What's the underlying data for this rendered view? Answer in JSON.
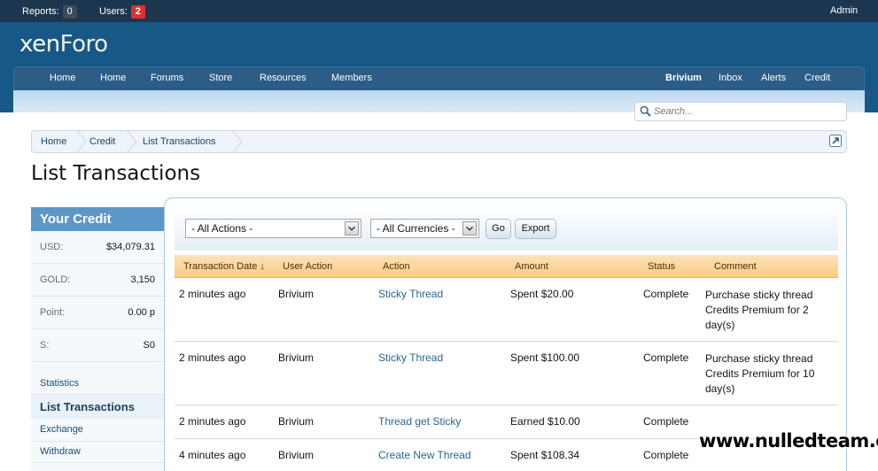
{
  "admin_bar": {
    "reports_label": "Reports:",
    "reports_count": "0",
    "users_label": "Users:",
    "users_count": "2",
    "admin_label": "Admin"
  },
  "header": {
    "logo_text_1": "xen",
    "logo_text_2": "Foro"
  },
  "nav": {
    "left_tabs": [
      "Home",
      "Home",
      "Forums",
      "Store",
      "Resources",
      "Members"
    ],
    "right_tabs": [
      "Brivium",
      "Inbox",
      "Alerts",
      "Credit"
    ]
  },
  "search": {
    "placeholder": "Search..."
  },
  "breadcrumb": [
    "Home",
    "Credit",
    "List Transactions"
  ],
  "page_title": "List Transactions",
  "sidebar": {
    "title": "Your Credit",
    "balances": [
      {
        "label": "USD:",
        "value": "$34,079.31"
      },
      {
        "label": "GOLD:",
        "value": "3,150"
      },
      {
        "label": "Point:",
        "value": "0.00 p"
      },
      {
        "label": "S:",
        "value": "S0"
      }
    ],
    "links": [
      "Statistics",
      "List Transactions",
      "Exchange",
      "Withdraw"
    ],
    "active_link": "List Transactions"
  },
  "filters": {
    "actions_value": "- All Actions -",
    "currencies_value": "- All Currencies -",
    "go_label": "Go",
    "export_label": "Export"
  },
  "table": {
    "columns": [
      "Transaction Date ↓",
      "User Action",
      "Action",
      "Amount",
      "Status",
      "Comment"
    ],
    "rows": [
      {
        "date": "2 minutes ago",
        "user": "Brivium",
        "action": "Sticky Thread",
        "amount": "Spent $20.00",
        "status": "Complete",
        "comment": " Purchase sticky thread Credits Premium for 2 day(s)"
      },
      {
        "date": "2 minutes ago",
        "user": "Brivium",
        "action": "Sticky Thread",
        "amount": "Spent $100.00",
        "status": "Complete",
        "comment": " Purchase sticky thread Credits Premium for 10 day(s)"
      },
      {
        "date": "2 minutes ago",
        "user": "Brivium",
        "action": "Thread get Sticky",
        "amount": "Earned $10.00",
        "status": "Complete",
        "comment": ""
      },
      {
        "date": "4 minutes ago",
        "user": "Brivium",
        "action": "Create New Thread",
        "amount": "Spent $108.34",
        "status": "Complete",
        "comment": ""
      }
    ]
  },
  "watermark": "www.nulledteam.com",
  "colors": {
    "header_bg": "#185886",
    "admin_bar_bg": "#1c3650",
    "sidebar_head_bg": "#5d97c9",
    "table_head_bg": "#f9cb86",
    "link_color": "#2a6593"
  }
}
